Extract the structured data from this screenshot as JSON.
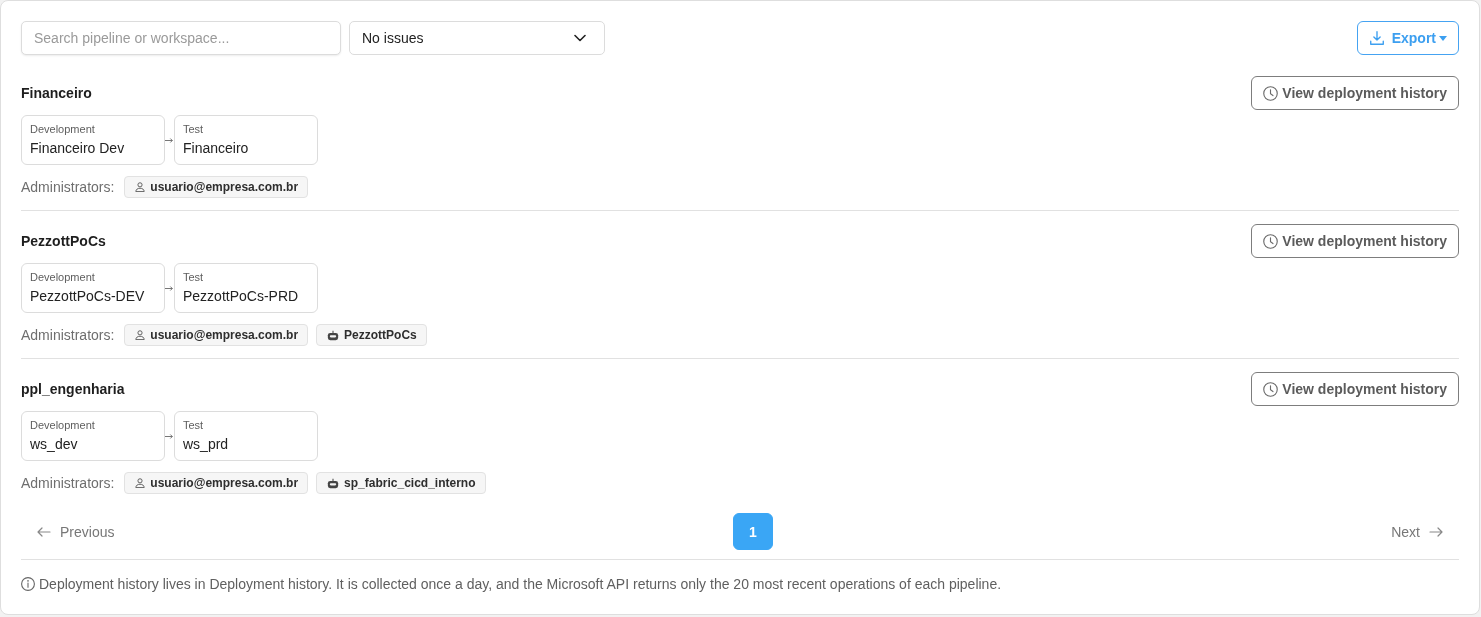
{
  "toolbar": {
    "search": {
      "placeholder": "Search pipeline or workspace..."
    },
    "filter": {
      "value": "No issues"
    },
    "export_button": {
      "label": "Export"
    }
  },
  "pipelines": [
    {
      "name": "Financeiro",
      "history_button": "View deployment history",
      "stages": [
        {
          "label": "Development",
          "workspace": "Financeiro Dev"
        },
        {
          "label": "Test",
          "workspace": "Financeiro"
        }
      ],
      "admins_label": "Administrators:",
      "admins": [
        {
          "kind": "user",
          "name": "usuario@empresa.com.br"
        }
      ]
    },
    {
      "name": "PezzottPoCs",
      "history_button": "View deployment history",
      "stages": [
        {
          "label": "Development",
          "workspace": "PezzottPoCs-DEV"
        },
        {
          "label": "Test",
          "workspace": "PezzottPoCs-PRD"
        }
      ],
      "admins_label": "Administrators:",
      "admins": [
        {
          "kind": "user",
          "name": "usuario@empresa.com.br"
        },
        {
          "kind": "service",
          "name": "PezzottPoCs"
        }
      ]
    },
    {
      "name": "ppl_engenharia",
      "history_button": "View deployment history",
      "stages": [
        {
          "label": "Development",
          "workspace": "ws_dev"
        },
        {
          "label": "Test",
          "workspace": "ws_prd"
        }
      ],
      "admins_label": "Administrators:",
      "admins": [
        {
          "kind": "user",
          "name": "usuario@empresa.com.br"
        },
        {
          "kind": "service",
          "name": "sp_fabric_cicd_interno"
        }
      ]
    }
  ],
  "pagination": {
    "previous": "Previous",
    "pages": [
      {
        "label": "1",
        "selected": true
      }
    ],
    "next": "Next"
  },
  "footer": {
    "note": "Deployment history lives in Deployment history. It is collected once a day, and the Microsoft API returns only the 20 most recent operations of each pipeline."
  }
}
